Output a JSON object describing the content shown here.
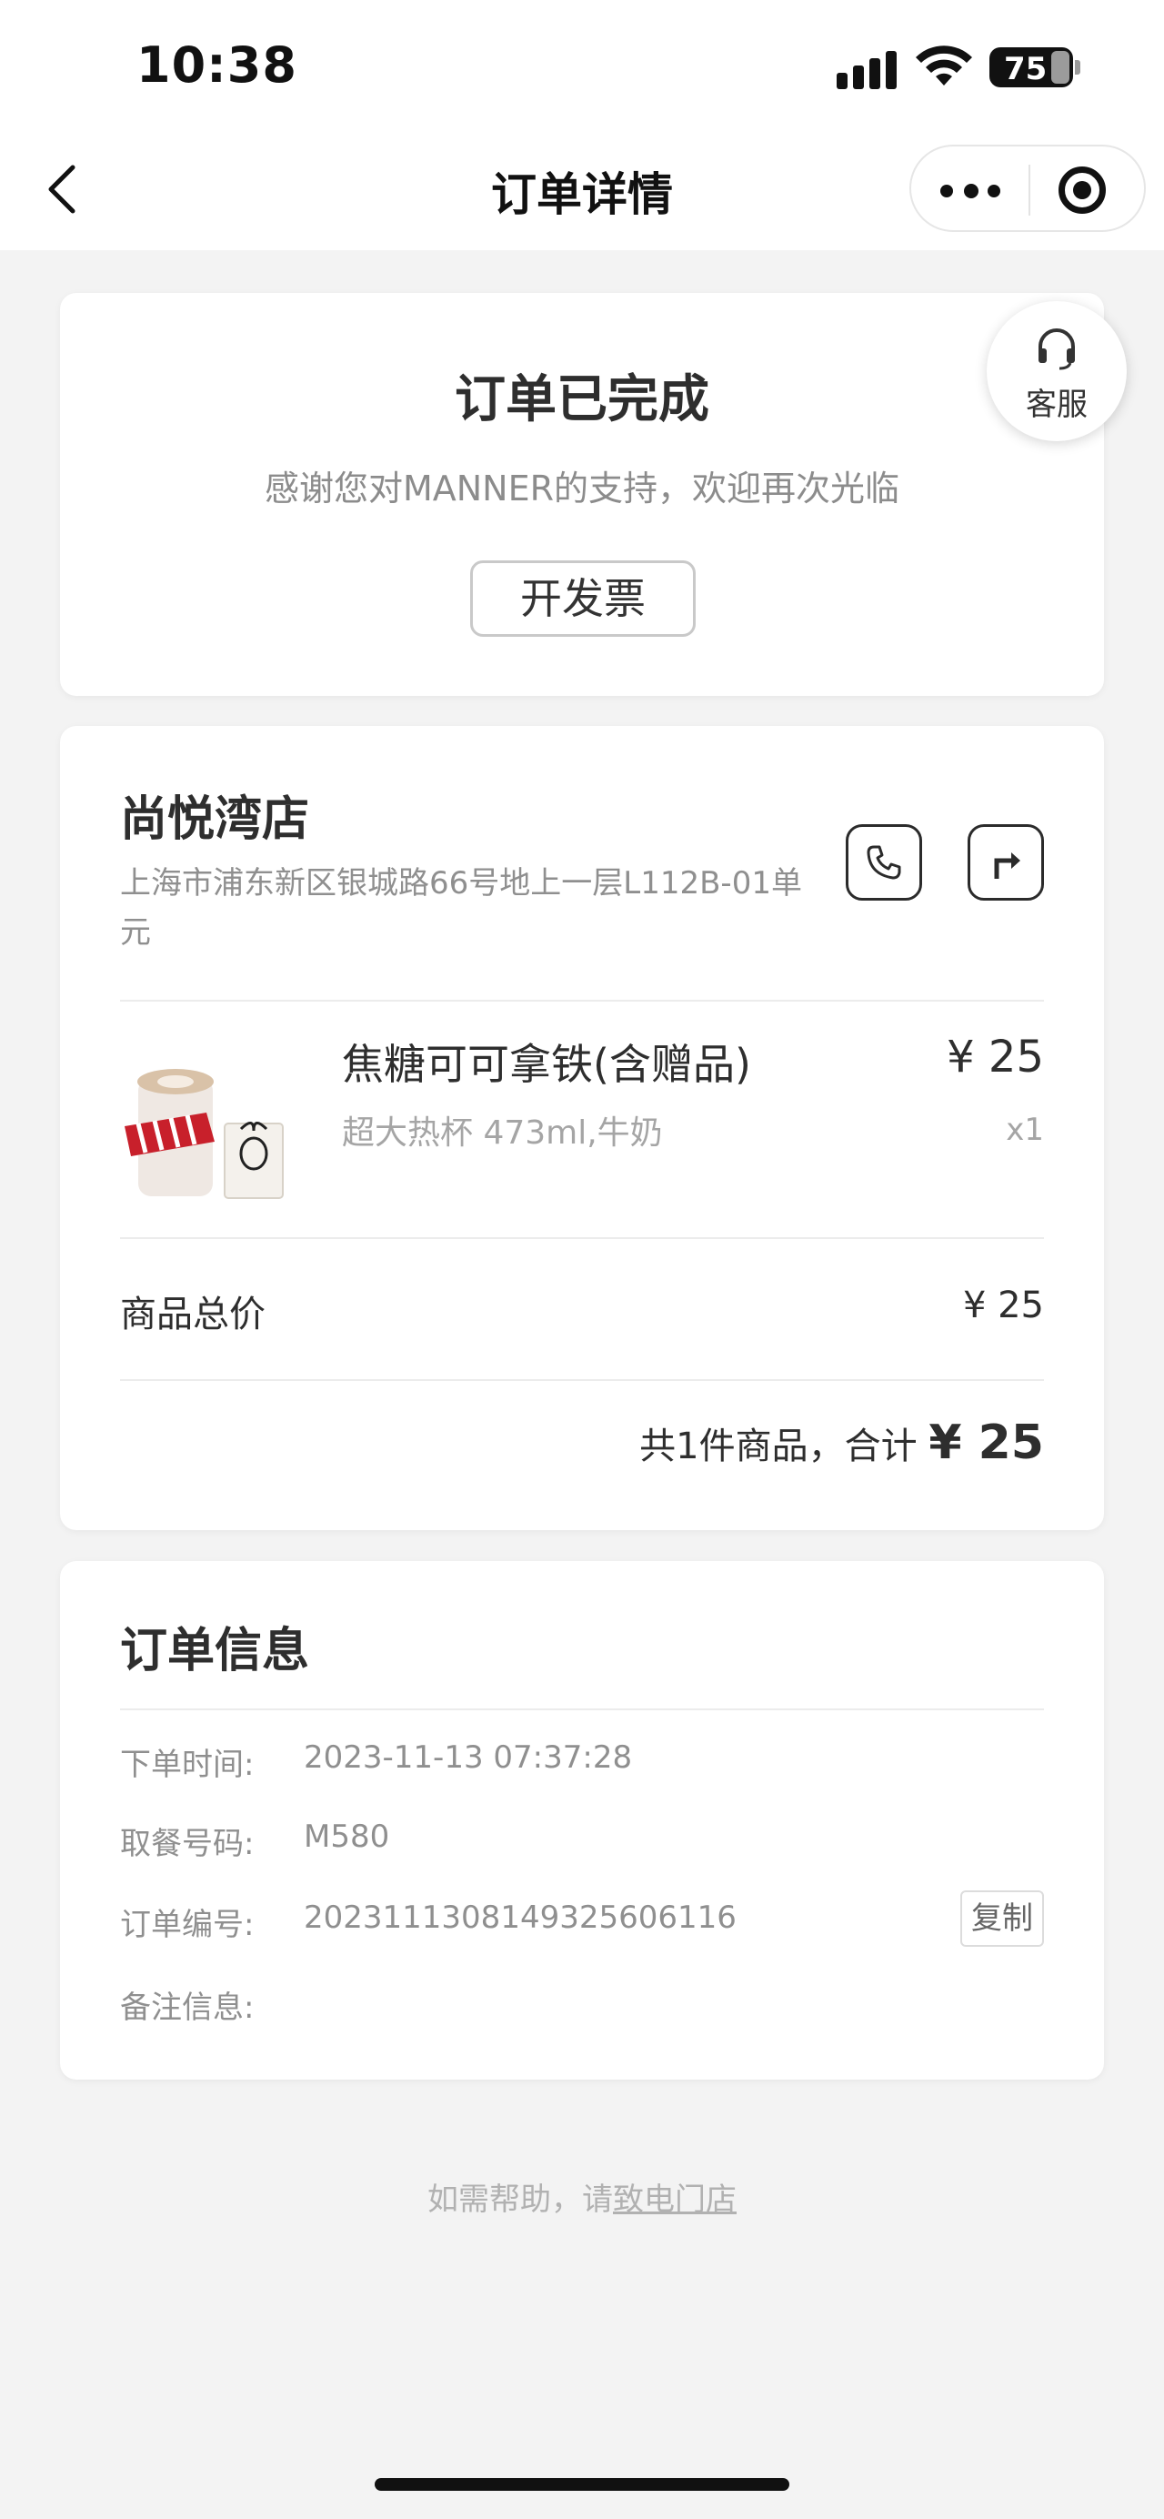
{
  "status_bar": {
    "time": "10:38",
    "battery": "75"
  },
  "nav": {
    "title": "订单详情"
  },
  "order_status": {
    "title": "订单已完成",
    "subtitle": "感谢您对MANNER的支持，欢迎再次光临",
    "invoice_button": "开发票"
  },
  "customer_service": {
    "label": "客服"
  },
  "store": {
    "name": "尚悦湾店",
    "address": "上海市浦东新区银城路66号地上一层L112B-01单元"
  },
  "product": {
    "name": "焦糖可可拿铁(含赠品)",
    "spec": "超大热杯 473ml,牛奶",
    "price": "¥ 25",
    "qty": "x1"
  },
  "summary": {
    "subtotal_label": "商品总价",
    "subtotal_value": "¥ 25",
    "total_text": "共1件商品，合计",
    "total_amount": "¥ 25"
  },
  "order_info": {
    "title": "订单信息",
    "rows": [
      {
        "label": "下单时间:",
        "value": "2023-11-13 07:37:28"
      },
      {
        "label": "取餐号码:",
        "value": "M580"
      },
      {
        "label": "订单编号:",
        "value": "20231113081493256061​16"
      },
      {
        "label": "备注信息:",
        "value": ""
      }
    ],
    "copy_button": "复制"
  },
  "help": {
    "prefix": "如需帮助，请",
    "link": "致电门店"
  },
  "colors": {
    "background": "#f3f3f3",
    "card": "#ffffff",
    "text": "#2e2e2e",
    "muted": "#8f8f8f"
  }
}
